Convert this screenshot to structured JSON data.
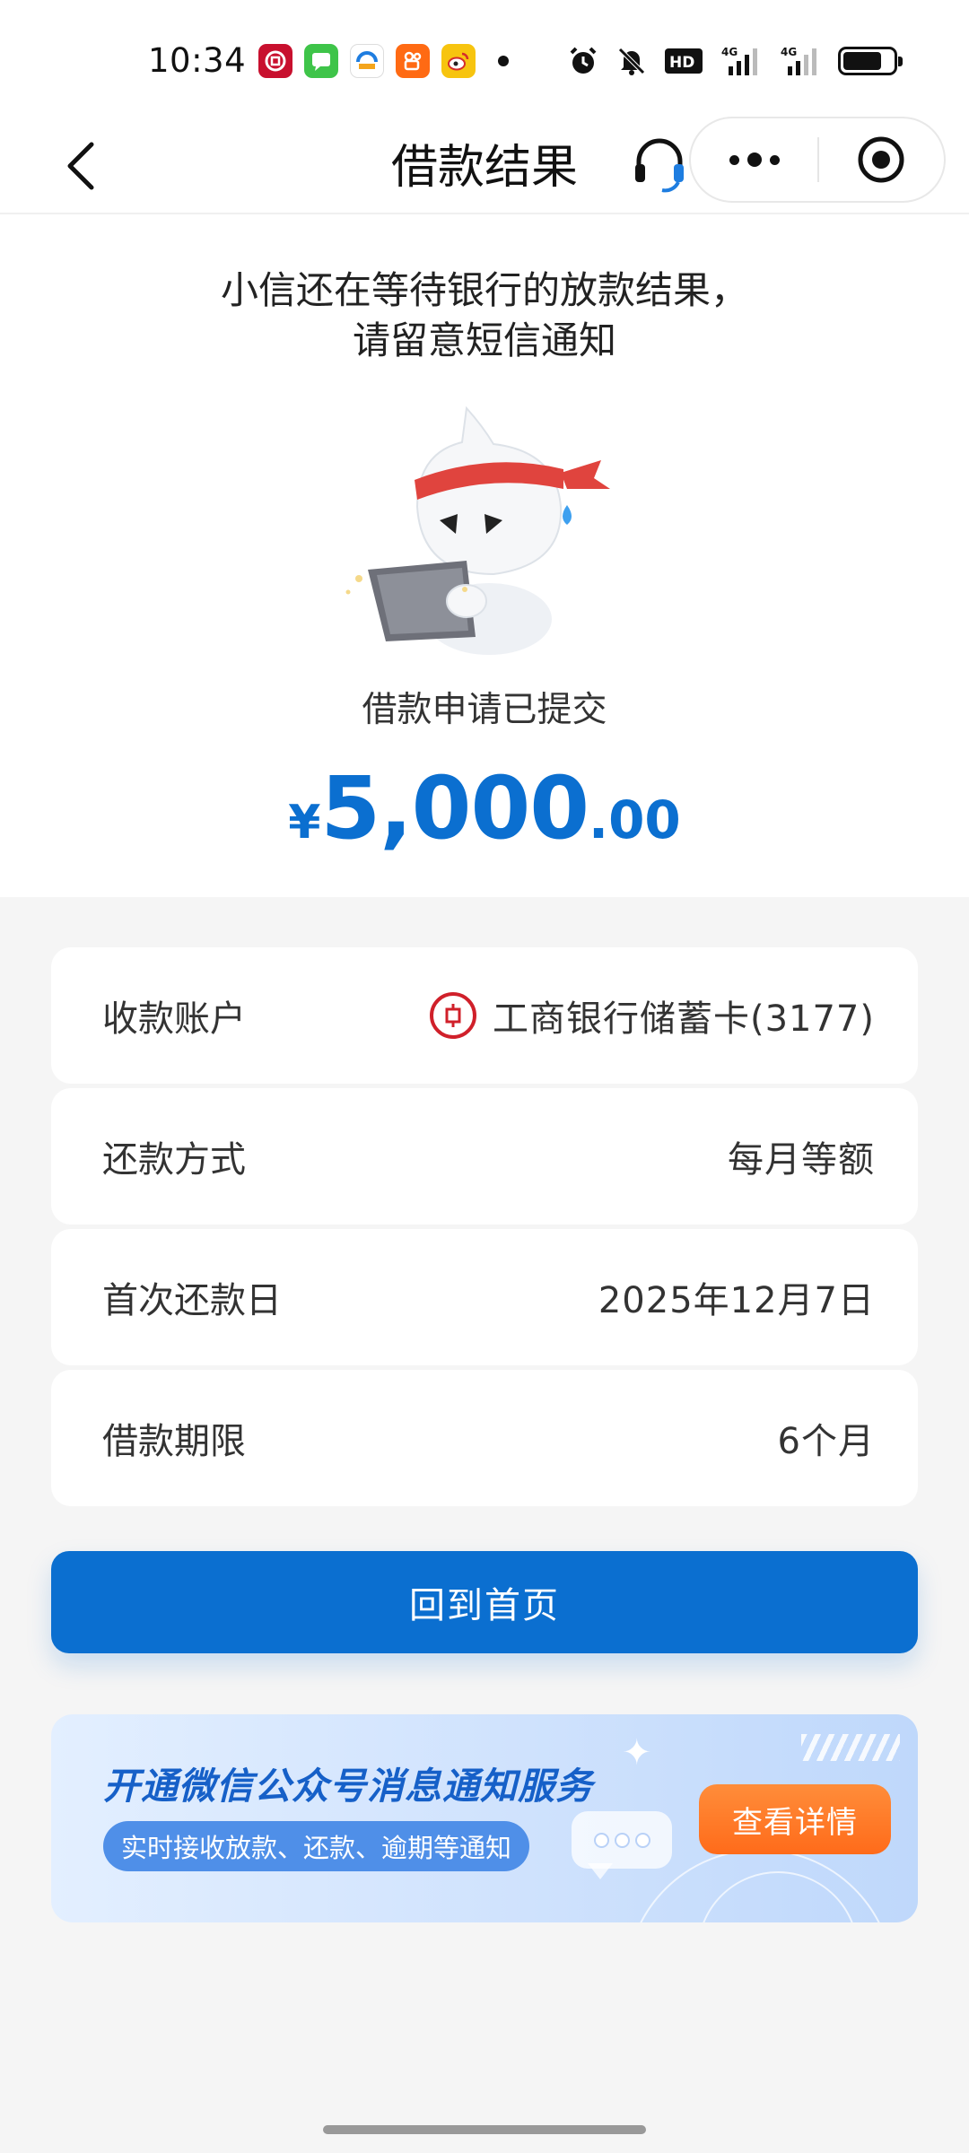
{
  "status_bar": {
    "time": "10:34",
    "app_icons": [
      {
        "name": "icbc-app-icon",
        "color": "#c8102e",
        "glyph": "⊡"
      },
      {
        "name": "messages-app-icon",
        "color": "#3ec449",
        "glyph": "▤"
      },
      {
        "name": "bank-app-icon",
        "color": "#f4a51c",
        "glyph": "⌂"
      },
      {
        "name": "kuaishou-app-icon",
        "color": "#ff6a13",
        "glyph": "◉"
      },
      {
        "name": "weibo-app-icon",
        "color": "#f7c40f",
        "glyph": "◐"
      }
    ],
    "hd_label": "HD",
    "network_1": "4G",
    "network_2": "4G"
  },
  "nav": {
    "title": "借款结果"
  },
  "hero": {
    "message_line1": "小信还在等待银行的放款结果，",
    "message_line2": "请留意短信通知",
    "status": "借款申请已提交",
    "currency": "¥",
    "amount_integer": "5,000",
    "amount_decimal": ".00"
  },
  "details": [
    {
      "label": "收款账户",
      "value": "工商银行储蓄卡(3177)",
      "bank_logo_text": "工"
    },
    {
      "label": "还款方式",
      "value": "每月等额"
    },
    {
      "label": "首次还款日",
      "value": "2025年12月7日"
    },
    {
      "label": "借款期限",
      "value": "6个月"
    }
  ],
  "home_button": "回到首页",
  "banner": {
    "title": "开通微信公众号消息通知服务",
    "subtitle": "实时接收放款、还款、逾期等通知",
    "button": "查看详情"
  },
  "colors": {
    "accent": "#0b6fd0",
    "orange": "#ff6b1a",
    "icbc_red": "#d0202a"
  }
}
